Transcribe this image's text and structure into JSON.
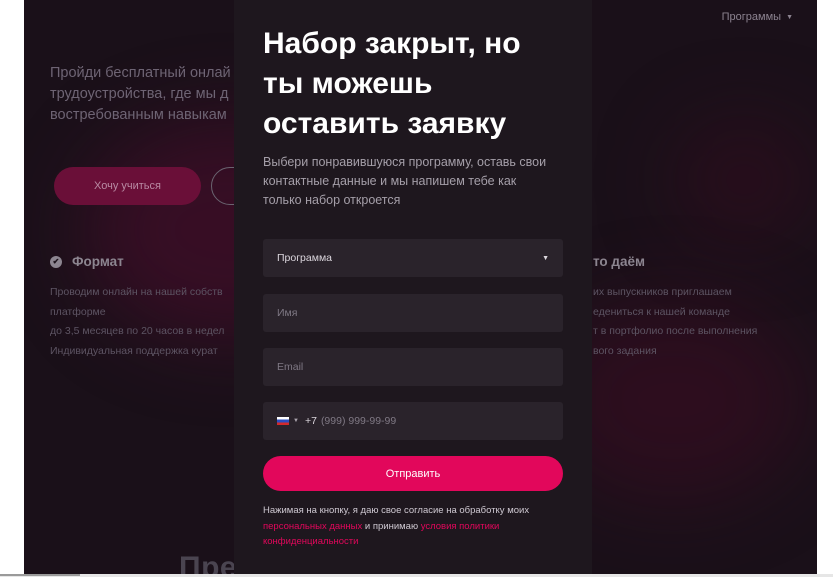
{
  "background": {
    "nav": {
      "programs_label": "Программы"
    },
    "hero": {
      "lines": [
        "Пройди бесплатный онлай",
        "трудоустройства, где мы д",
        "востребованным навыкам"
      ],
      "want_button": "Хочу учиться"
    },
    "format": {
      "title": "Формат",
      "lines": [
        "Проводим онлайн на нашей собств",
        "платформе",
        "до 3,5 месяцев по 20 часов в недел",
        "Индивидуальная поддержка курат"
      ]
    },
    "give": {
      "title": "то даём",
      "lines": [
        "их выпускников приглашаем",
        "едениться к нашей команде",
        "т в портфолио после выполнения",
        "вого задания"
      ]
    },
    "bottom_heading": "Преподаватели курсов"
  },
  "modal": {
    "title_lines": [
      "Набор закрыт, но",
      "ты можешь",
      "оставить заявку"
    ],
    "subtitle_lines": [
      "Выбери понравившуюся программу, оставь свои",
      "контактные данные и мы напишем тебе как",
      "только набор откроется"
    ],
    "program_select": {
      "value": "Программа"
    },
    "name_field": {
      "placeholder": "Имя"
    },
    "email_field": {
      "placeholder": "Email"
    },
    "phone_field": {
      "code": "+7",
      "placeholder": "(999) 999-99-99"
    },
    "submit_label": "Отправить",
    "consent": {
      "text_1": "Нажимая на кнопку, я даю свое согласие на обработку моих",
      "link_1": "персональных данных",
      "text_2": " и принимаю ",
      "link_2": "условия политики конфиденциальности"
    }
  },
  "colors": {
    "accent": "#e2075b",
    "modal_bg": "#1e171e",
    "field_bg": "#2a232b",
    "page_bg": "#1a1019"
  }
}
